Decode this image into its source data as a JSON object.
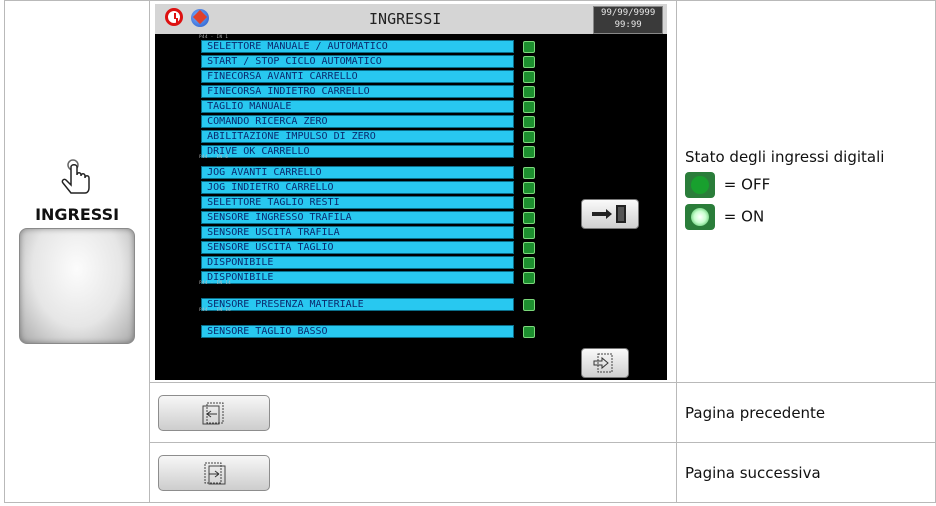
{
  "left_cell": {
    "label": "INGRESSI"
  },
  "screen": {
    "title": "INGRESSI",
    "date": "99/99/9999",
    "time": "99:99",
    "groups": [
      "P44 - IN 1",
      "P44 - IN 6",
      "P44 - IN 14",
      "P44 - IN 16"
    ],
    "inputs": [
      "SELETTORE MANUALE / AUTOMATICO",
      "START / STOP CICLO AUTOMATICO",
      "FINECORSA AVANTI CARRELLO",
      "FINECORSA INDIETRO CARRELLO",
      "TAGLIO MANUALE",
      "COMANDO RICERCA ZERO",
      "ABILITAZIONE IMPULSO DI ZERO",
      "DRIVE OK CARRELLO",
      "JOG AVANTI CARRELLO",
      "JOG INDIETRO CARRELLO",
      "SELETTORE TAGLIO RESTI",
      "SENSORE INGRESSO TRAFILA",
      "SENSORE USCITA TRAFILA",
      "SENSORE USCITA TAGLIO",
      "DISPONIBILE",
      "DISPONIBILE",
      "SENSORE PRESENZA MATERIALE",
      "SENSORE TAGLIO BASSO"
    ]
  },
  "right_cell": {
    "title": "Stato degli ingressi digitali",
    "off_label": "= OFF",
    "on_label": "= ON"
  },
  "rows": [
    {
      "description": "Pagina precedente",
      "icon": "page-prev-icon"
    },
    {
      "description": "Pagina successiva",
      "icon": "page-next-icon"
    }
  ]
}
